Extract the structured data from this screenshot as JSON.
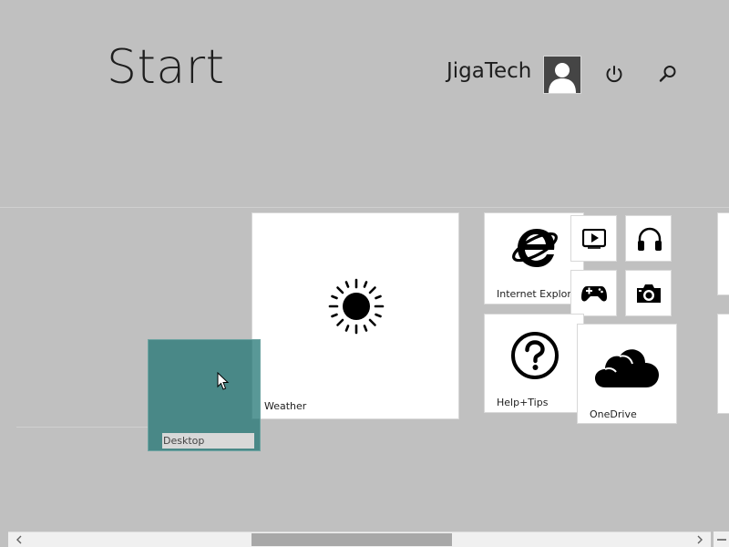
{
  "header": {
    "title": "Start",
    "user_name": "JigaTech",
    "avatar_icon": "user-avatar-icon",
    "power_icon": "power-icon",
    "search_icon": "search-icon"
  },
  "tiles": {
    "weather": {
      "label": "Weather",
      "icon": "sun-icon"
    },
    "internet_explorer": {
      "label": "Internet Explorer",
      "icon": "internet-explorer-icon"
    },
    "help_tips": {
      "label": "Help+Tips",
      "icon": "question-mark-icon"
    },
    "onedrive": {
      "label": "OneDrive",
      "icon": "cloud-icon"
    },
    "video": {
      "icon": "video-icon"
    },
    "music": {
      "icon": "headphones-icon"
    },
    "games": {
      "icon": "gamepad-icon"
    },
    "camera": {
      "icon": "camera-icon"
    },
    "desktop": {
      "label": "Desktop",
      "color": "#2a7a78"
    }
  },
  "scrollbar": {
    "left_icon": "chevron-left-icon",
    "right_icon": "chevron-right-icon",
    "zoom_icon": "zoom-out-icon"
  },
  "colors": {
    "background": "#c0c0c0",
    "tile": "#ffffff",
    "desktop_tile": "#2a7a78"
  }
}
